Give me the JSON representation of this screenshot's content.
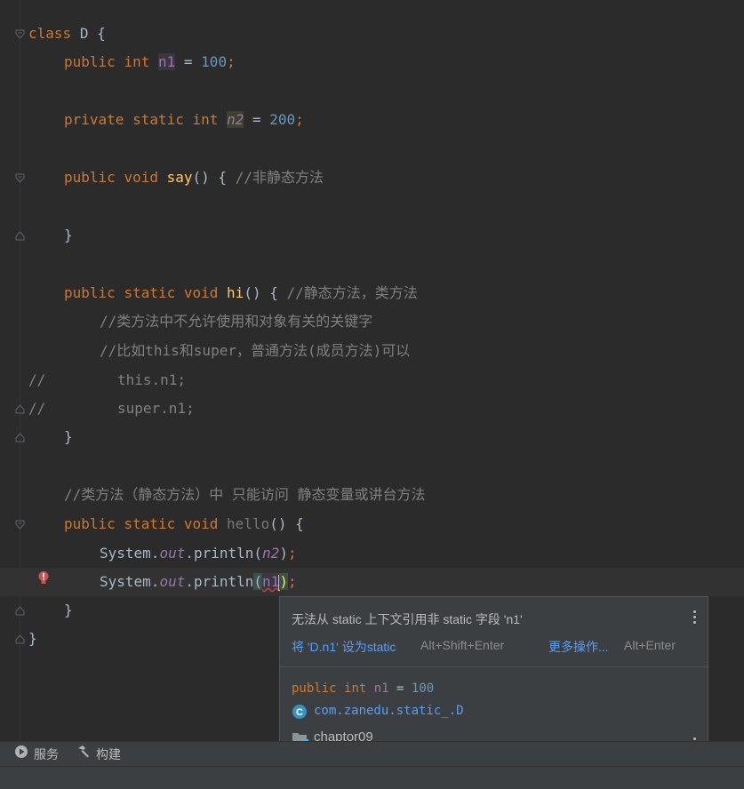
{
  "editor": {
    "line1": {
      "kw": "class",
      "name": "D",
      "brace": "{"
    },
    "line2": {
      "kw1": "public",
      "kw2": "int",
      "field": "n1",
      "eq": "=",
      "value": "100",
      "semi": ";"
    },
    "line3": {
      "kw1": "private",
      "kw2": "static",
      "kw3": "int",
      "field": "n2",
      "eq": "=",
      "value": "200",
      "semi": ";"
    },
    "line4": {
      "kw1": "public",
      "kw2": "void",
      "method": "say",
      "rest": "() {",
      "comment": "//非静态方法"
    },
    "line5": {
      "text": "}"
    },
    "line6": {
      "kw1": "public",
      "kw2": "static",
      "kw3": "void",
      "method": "hi",
      "rest": "() {",
      "comment": "//静态方法，类方法"
    },
    "line7": {
      "comment": "//类方法中不允许使用和对象有关的关键字"
    },
    "line8": {
      "comment": "//比如this和super，普通方法(成员方法)可以"
    },
    "line9": {
      "prefix": "//",
      "code": "this.n1;"
    },
    "line10": {
      "prefix": "//",
      "code": "super.n1;"
    },
    "line11": {
      "text": "}"
    },
    "line12": {
      "comment": "//类方法（静态方法）中 只能访问 静态变量或讲台方法"
    },
    "line13": {
      "kw1": "public",
      "kw2": "static",
      "kw3": "void",
      "method": "hello",
      "rest": "() {"
    },
    "line14": {
      "cls": "System",
      "dot1": ".",
      "out": "out",
      "call": ".println(",
      "arg": "n2",
      "close": ")",
      "semi": ";"
    },
    "line15": {
      "cls": "System",
      "dot1": ".",
      "out": "out",
      "call": ".println",
      "open": "(",
      "arg": "n1",
      "close": ")",
      "semi": ";"
    },
    "line16": {
      "text": "}"
    },
    "line17": {
      "text": "}"
    }
  },
  "popup": {
    "message": "无法从 static 上下文引用非 static 字段 'n1'",
    "fix_label": "将 'D.n1' 设为static",
    "fix_shortcut": "Alt+Shift+Enter",
    "more_label": "更多操作...",
    "more_shortcut": "Alt+Enter",
    "decl_kw1": "public",
    "decl_kw2": "int",
    "decl_field": "n1",
    "decl_eq": "=",
    "decl_value": "100",
    "class_path": "com.zanedu.static_.D",
    "module": "chaptor09"
  },
  "bottombar": {
    "services_label": "服务",
    "build_label": "构建"
  },
  "colors": {
    "background": "#2b2b2b",
    "keyword": "#cc7832",
    "field": "#9876aa",
    "number": "#6897bb",
    "method": "#ffc66d",
    "comment": "#808080",
    "link": "#589df6",
    "error": "#db5c5c"
  },
  "icons": {
    "error": "error-bulb-icon",
    "services": "services-icon",
    "build": "hammer-icon",
    "class": "class-icon",
    "module": "folder-icon",
    "menu": "kebab-menu-icon"
  }
}
